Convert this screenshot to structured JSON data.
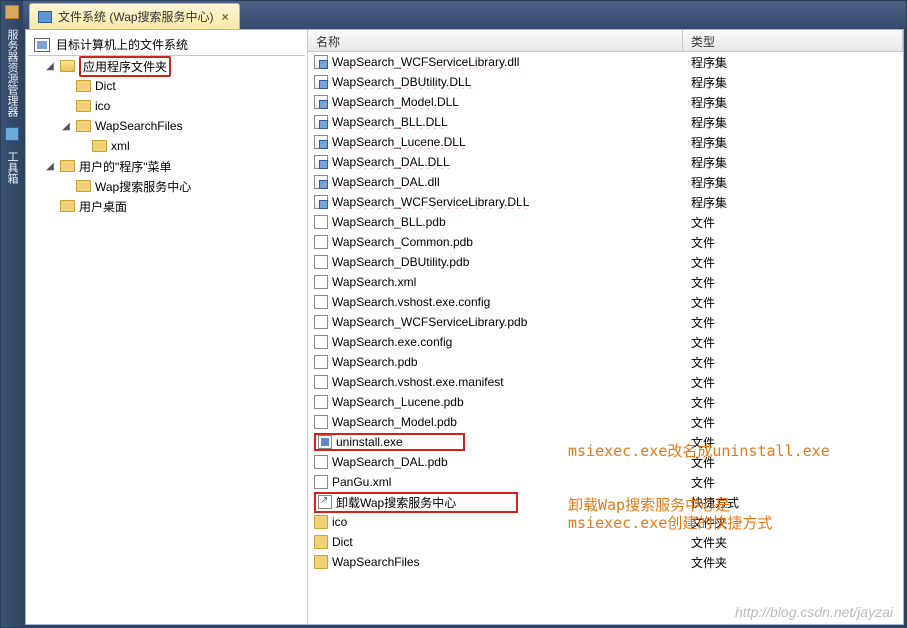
{
  "sidebar": {
    "tab1": "服务器资源管理器",
    "tab2": "工具箱"
  },
  "tab": {
    "title": "文件系统 (Wap搜索服务中心)",
    "close": "×"
  },
  "treeHeader": "目标计算机上的文件系统",
  "tree": {
    "appFolder": "应用程序文件夹",
    "dict": "Dict",
    "ico": "ico",
    "wsf": "WapSearchFiles",
    "xml": "xml",
    "userProg": "用户的\"程序\"菜单",
    "wapCenter": "Wap搜索服务中心",
    "userDesktop": "用户桌面"
  },
  "cols": {
    "name": "名称",
    "type": "类型"
  },
  "types": {
    "asm": "程序集",
    "file": "文件",
    "lnk": "快捷方式",
    "folder": "文件夹"
  },
  "rows": [
    {
      "n": "WapSearch_WCFServiceLibrary.dll",
      "t": "asm",
      "i": "asm",
      "s": 1
    },
    {
      "n": "WapSearch_DBUtility.DLL",
      "t": "asm",
      "i": "asm",
      "s": 1
    },
    {
      "n": "WapSearch_Model.DLL",
      "t": "asm",
      "i": "asm",
      "s": 1
    },
    {
      "n": "WapSearch_BLL.DLL",
      "t": "asm",
      "i": "asm",
      "s": 1
    },
    {
      "n": "WapSearch_Lucene.DLL",
      "t": "asm",
      "i": "asm",
      "s": 1
    },
    {
      "n": "WapSearch_DAL.DLL",
      "t": "asm",
      "i": "asm",
      "s": 1
    },
    {
      "n": "WapSearch_DAL.dll",
      "t": "asm",
      "i": "asm",
      "s": 1
    },
    {
      "n": "WapSearch_WCFServiceLibrary.DLL",
      "t": "asm",
      "i": "asm",
      "s": 1
    },
    {
      "n": "WapSearch_BLL.pdb",
      "t": "file",
      "i": "file"
    },
    {
      "n": "WapSearch_Common.pdb",
      "t": "file",
      "i": "file"
    },
    {
      "n": "WapSearch_DBUtility.pdb",
      "t": "file",
      "i": "file"
    },
    {
      "n": "WapSearch.xml",
      "t": "file",
      "i": "file"
    },
    {
      "n": "WapSearch.vshost.exe.config",
      "t": "file",
      "i": "file"
    },
    {
      "n": "WapSearch_WCFServiceLibrary.pdb",
      "t": "file",
      "i": "file"
    },
    {
      "n": "WapSearch.exe.config",
      "t": "file",
      "i": "file"
    },
    {
      "n": "WapSearch.pdb",
      "t": "file",
      "i": "file"
    },
    {
      "n": "WapSearch.vshost.exe.manifest",
      "t": "file",
      "i": "file"
    },
    {
      "n": "WapSearch_Lucene.pdb",
      "t": "file",
      "i": "file"
    },
    {
      "n": "WapSearch_Model.pdb",
      "t": "file",
      "i": "file"
    },
    {
      "n": "uninstall.exe",
      "t": "file",
      "i": "exe",
      "box": 1
    },
    {
      "n": "WapSearch_DAL.pdb",
      "t": "file",
      "i": "file"
    },
    {
      "n": "PanGu.xml",
      "t": "file",
      "i": "file"
    },
    {
      "n": "卸载Wap搜索服务中心",
      "t": "lnk",
      "i": "lnk",
      "box": 1
    },
    {
      "n": "ico",
      "t": "folder",
      "i": "folder"
    },
    {
      "n": "Dict",
      "t": "folder",
      "i": "folder"
    },
    {
      "n": "WapSearchFiles",
      "t": "folder",
      "i": "folder"
    }
  ],
  "anno": {
    "a1": "msiexec.exe改名成uninstall.exe",
    "a2a": "卸载Wap搜索服务中心是",
    "a2b": "msiexec.exe创建的快捷方式"
  },
  "watermark": "http://blog.csdn.net/jayzai"
}
